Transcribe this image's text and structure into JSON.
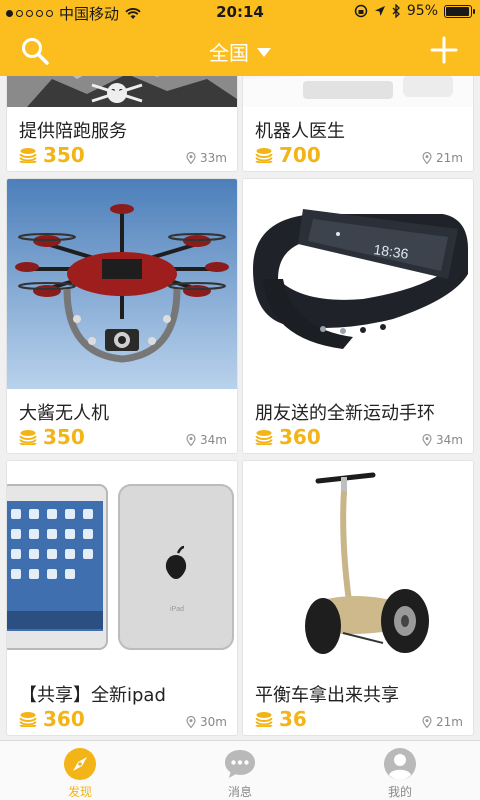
{
  "status": {
    "carrier": "中国移动",
    "time": "20:14",
    "battery": "95%",
    "battery_level": 0.95
  },
  "nav": {
    "title": "全国"
  },
  "icons": {
    "search": "search-icon",
    "dropdown": "caret-down-icon",
    "add": "plus-icon",
    "price": "coin-stack-icon",
    "location": "location-pin-icon"
  },
  "colors": {
    "brand": "#fcbe1f",
    "price": "#f2b416"
  },
  "items": [
    {
      "title": "提供陪跑服务",
      "price": "350",
      "distance": "33m"
    },
    {
      "title": "机器人医生",
      "price": "700",
      "distance": "21m"
    },
    {
      "title": "大酱无人机",
      "price": "350",
      "distance": "34m"
    },
    {
      "title": "朋友送的全新运动手环",
      "price": "360",
      "distance": "34m"
    },
    {
      "title": "【共享】全新ipad",
      "price": "360",
      "distance": "30m"
    },
    {
      "title": "平衡车拿出来共享",
      "price": "36",
      "distance": "21m"
    }
  ],
  "tabs": [
    {
      "label": "发现",
      "icon": "compass-icon",
      "active": true
    },
    {
      "label": "消息",
      "icon": "chat-bubble-icon",
      "active": false
    },
    {
      "label": "我的",
      "icon": "user-avatar-icon",
      "active": false
    }
  ]
}
